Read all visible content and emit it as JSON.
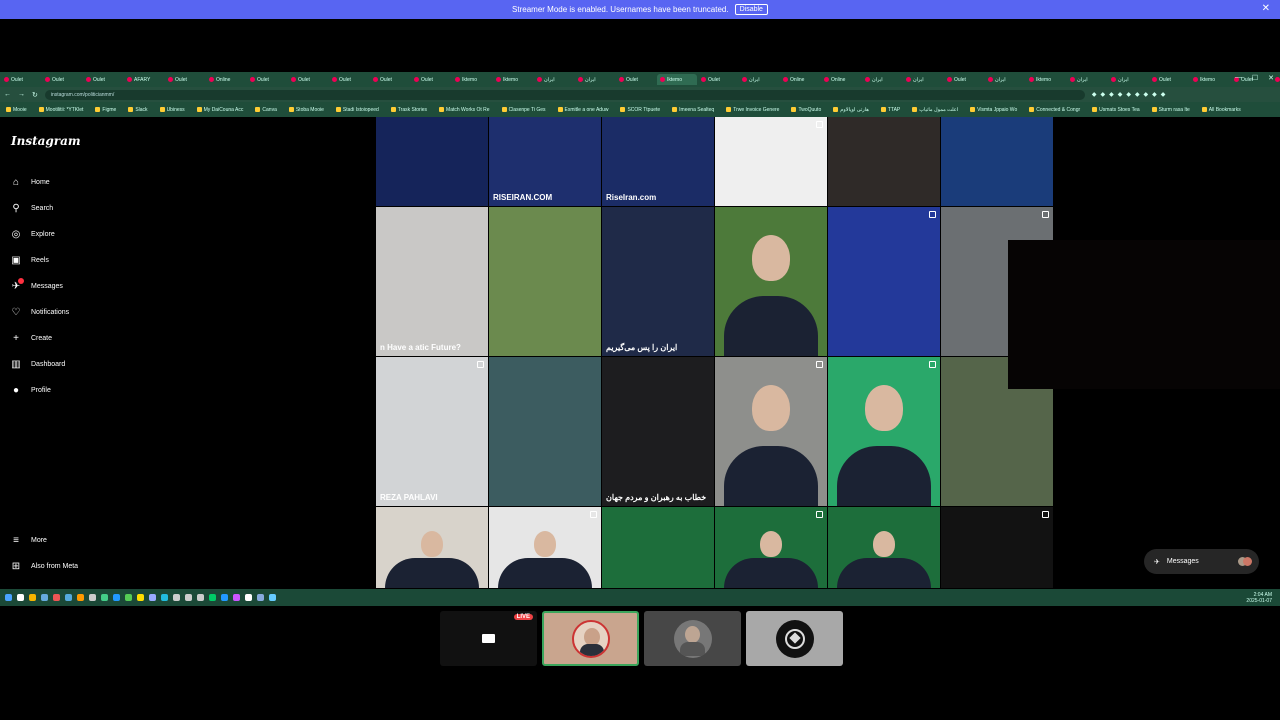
{
  "banner": {
    "text": "Streamer Mode is enabled. Usernames have been truncated.",
    "button": "Disable",
    "close": "✕"
  },
  "browser": {
    "tabs": [
      "Oulet",
      "Oulet",
      "Oulet",
      "AFARY",
      "Oulet",
      "Online",
      "Oulet",
      "Oulet",
      "Oulet",
      "Oulet",
      "Oulet",
      "Iktemo",
      "Iktemo",
      "ایران",
      "ایران",
      "Oulet",
      "Iktemo",
      "Oulet",
      "ایران",
      "Online",
      "Online",
      "ایران",
      "ایران",
      "Oulet",
      "ایران",
      "Iktemo",
      "ایران",
      "ایران",
      "Oulet",
      "Iktemo",
      "Oulet",
      "ایران"
    ],
    "active_tab": 16,
    "address": "instagram.com/politicianmm/",
    "bookmarks": [
      "Mooie",
      "Mootilitii: *YTKlet",
      "Figme",
      "Slack",
      "Ubiness",
      "My DaiCouna Acc",
      "Canva",
      "Stoba Mooie",
      "Stadi Istoiopeed",
      "Trask Stories",
      "Match Works Ot Re",
      "Clasenpe Ti Ges",
      "Esmitle a one Aduw",
      "SCOR Ttpuete",
      "Imeena Sealteq",
      "Trwe Invoice Genere",
      "TwoQuuto",
      "هارتی اوپالاوم",
      "TTAP",
      "اعلت ممول ماتیاپ",
      "Vismta Jppaio Wo",
      "Connected & Congr",
      "Usmats Stoes Tea",
      "Sturm rasa lte",
      "All Bookmarks"
    ],
    "tray_time": "2:04 AM",
    "tray_date": "2025-01-07"
  },
  "instagram": {
    "logo": "Instagram",
    "nav": [
      {
        "label": "Home",
        "icon": "⌂"
      },
      {
        "label": "Search",
        "icon": "⚲"
      },
      {
        "label": "Explore",
        "icon": "◎"
      },
      {
        "label": "Reels",
        "icon": "▣"
      },
      {
        "label": "Messages",
        "icon": "✈",
        "badge": "1"
      },
      {
        "label": "Notifications",
        "icon": "♡"
      },
      {
        "label": "Create",
        "icon": "+"
      },
      {
        "label": "Dashboard",
        "icon": "▥"
      },
      {
        "label": "Profile",
        "icon": "●"
      }
    ],
    "bottom": [
      {
        "label": "More",
        "icon": "≡"
      },
      {
        "label": "Also from Meta",
        "icon": "⊞"
      }
    ],
    "posts": [
      {
        "bg": "#15245a",
        "cap": ""
      },
      {
        "bg": "#1e2f6e",
        "cap": "RISEIRAN.COM"
      },
      {
        "bg": "#1b2c66",
        "cap": "RiseIran.com"
      },
      {
        "bg": "#efefef",
        "cap": ""
      },
      {
        "bg": "#2f2a28",
        "cap": ""
      },
      {
        "bg": "#1a3c7a",
        "cap": ""
      },
      {
        "bg": "#c9c8c6",
        "cap": "n Have a atic Future?"
      },
      {
        "bg": "#6b8a4e",
        "cap": ""
      },
      {
        "bg": "#1f2a48",
        "cap": "ایران را پس می‌گیریم"
      },
      {
        "bg": "#4d7a3a",
        "cap": ""
      },
      {
        "bg": "#23399a",
        "cap": ""
      },
      {
        "bg": "#6b6f72",
        "cap": ""
      },
      {
        "bg": "#d2d4d6",
        "cap": "REZA PAHLAVI"
      },
      {
        "bg": "#3c5c60",
        "cap": ""
      },
      {
        "bg": "#1d1d1f",
        "cap": "خطاب به رهبران و مردم جهان"
      },
      {
        "bg": "#8e8f8c",
        "cap": ""
      },
      {
        "bg": "#2aa86a",
        "cap": ""
      },
      {
        "bg": "#55654a",
        "cap": ""
      },
      {
        "bg": "#d8d3cb",
        "cap": ""
      },
      {
        "bg": "#e6e6e6",
        "cap": ""
      },
      {
        "bg": "#1d6e3b",
        "cap": ""
      },
      {
        "bg": "#1d6e3b",
        "cap": ""
      },
      {
        "bg": "#1d6e3b",
        "cap": ""
      },
      {
        "bg": "#121212",
        "cap": ""
      }
    ],
    "messages_pill": {
      "label": "Messages",
      "badge": "1"
    }
  },
  "call": {
    "live_label": "LIVE",
    "tiles": [
      "stream",
      "user-1",
      "user-2",
      "user-3"
    ]
  }
}
